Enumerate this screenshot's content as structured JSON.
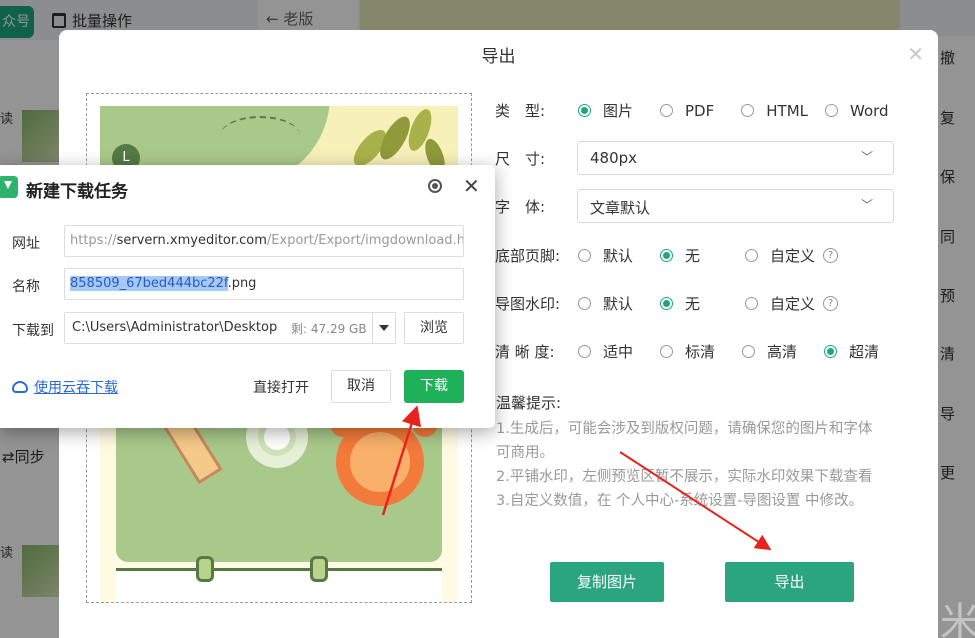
{
  "background": {
    "account_button": "众号",
    "batch_label": "批量操作",
    "old_version": "老版",
    "side_label_1": "读",
    "side_label_2": "读",
    "sync_label": "同步",
    "right_items": [
      "撤",
      "复",
      "保",
      "同",
      "预",
      "清",
      "导",
      "更"
    ]
  },
  "export_dialog": {
    "title": "导出",
    "type": {
      "label": "类　型:",
      "options": [
        "图片",
        "PDF",
        "HTML",
        "Word"
      ],
      "selected": "图片"
    },
    "size": {
      "label": "尺　寸:",
      "value": "480px"
    },
    "font": {
      "label": "字　体:",
      "value": "文章默认"
    },
    "footer": {
      "label": "底部页脚:",
      "options": [
        "默认",
        "无",
        "自定义"
      ],
      "selected": "无"
    },
    "watermark": {
      "label": "导图水印:",
      "options": [
        "默认",
        "无",
        "自定义"
      ],
      "selected": "无"
    },
    "clarity": {
      "label": "清 晰 度:",
      "options": [
        "适中",
        "标清",
        "高清",
        "超清"
      ],
      "selected": "超清"
    },
    "tips_title": "温馨提示:",
    "tips": [
      "1.生成后，可能会涉及到版权问题，请确保您的图片和字体",
      "可商用。",
      "2.平铺水印，左侧预览区暂不展示，实际水印效果下载查看",
      "3.自定义数值，在 个人中心-系统设置-导图设置 中修改。"
    ],
    "copy_button": "复制图片",
    "export_button": "导出",
    "preview_badge": "L"
  },
  "download_dialog": {
    "title": "新建下载任务",
    "url_label": "网址",
    "url_prefix": "https://",
    "url_host": "servern.xmyeditor.com",
    "url_path": "/Export/Export/imgdownload.html",
    "name_label": "名称",
    "name_selected": "858509_67bed444bc22f",
    "name_ext": ".png",
    "save_label": "下载到",
    "save_path": "C:\\Users\\Administrator\\Desktop",
    "free_space": "剩: 47.29 GB",
    "browse_button": "浏览",
    "cloud_link": "使用云吞下载",
    "open_button": "直接打开",
    "cancel_button": "取消",
    "download_button": "下载"
  },
  "colors": {
    "accent_green": "#2aa57e",
    "download_green": "#1fb15a",
    "arrow_red": "#e8231e"
  }
}
